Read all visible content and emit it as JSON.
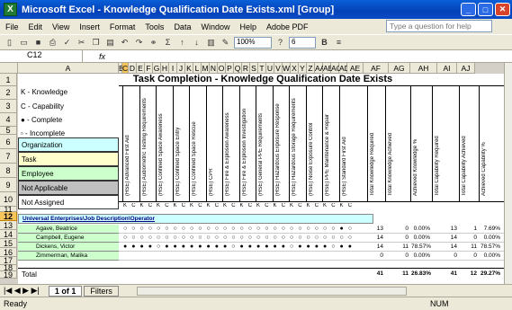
{
  "window": {
    "title": "Microsoft Excel - Knowledge Qualification Date Exists.xml  [Group]"
  },
  "menu": [
    "File",
    "Edit",
    "View",
    "Insert",
    "Format",
    "Tools",
    "Data",
    "Window",
    "Help",
    "Adobe PDF"
  ],
  "help_placeholder": "Type a question for help",
  "toolbar": {
    "zoom": "100%",
    "font_size": "6"
  },
  "formula": {
    "namebox": "C12",
    "fx": "fx"
  },
  "columns": [
    "A",
    "B",
    "C",
    "D",
    "E",
    "F",
    "G",
    "H",
    "I",
    "J",
    "K",
    "L",
    "M",
    "N",
    "O",
    "P",
    "Q",
    "R",
    "S",
    "T",
    "U",
    "V",
    "W",
    "X",
    "Y",
    "Z",
    "AA",
    "AB",
    "AC",
    "AD",
    "AE",
    "AF",
    "AG",
    "AH",
    "AI",
    "AJ"
  ],
  "sheet": {
    "title": "Task Completion  - Knowledge Qualification Date Exists",
    "legend": [
      "K - Knowledge",
      "C - Capability",
      "● - Complete",
      "▫ - Incomplete"
    ],
    "boxes": [
      {
        "label": "Organization",
        "color": "#ccffff"
      },
      {
        "label": "Task",
        "color": "#ffffcc"
      },
      {
        "label": "Employee",
        "color": "#ccffcc"
      },
      {
        "label": "Not Applicable",
        "color": "#c0c0c0"
      },
      {
        "label": "Not Assigned",
        "color": "#ffffff"
      }
    ],
    "tasks": [
      "(HSE) Advanced First Aid",
      "(HSE) Audiometric Testing Requirements",
      "(HSE) Confined Space Awareness",
      "(HSE) Confined Space Entry",
      "(HSE) Confined Space Rescue",
      "(HSE) CPR",
      "(HSE) Fire & Explosion Awareness",
      "(HSE) Fire & Explosion Investigation",
      "(HSE) General PPE Requirements",
      "(HSE) Hazardous Exposure Response",
      "(HSE) Hazardous Storage Requirements",
      "(HSE) Noise Exposure Control",
      "(HSE) PPE Maintenance & Repair",
      "(HSE) Standard First Aid"
    ],
    "summary_headers": [
      "Total Knowledge Required",
      "Total Knowledge Achieved",
      "Achieved Knowledge %",
      "Total Capability Required",
      "Total Capability Achieved",
      "Achieved Capability %"
    ],
    "kc_row": [
      "K",
      "C",
      "K",
      "C",
      "K",
      "C",
      "K",
      "C",
      "K",
      "C",
      "K",
      "C",
      "K",
      "C",
      "K",
      "C",
      "K",
      "C",
      "K",
      "C",
      "K",
      "C",
      "K",
      "C",
      "K",
      "C",
      "K",
      "C"
    ],
    "org": "Universal Enterprises\\Job Description\\Operator",
    "employees": [
      {
        "name": "Agave, Beatrice",
        "stats": [
          "13",
          "0",
          "0.00%",
          "13",
          "1",
          "7.69%"
        ]
      },
      {
        "name": "Campbell, Eugene",
        "stats": [
          "14",
          "0",
          "0.00%",
          "14",
          "0",
          "0.00%"
        ]
      },
      {
        "name": "Dickens, Victor",
        "stats": [
          "14",
          "11",
          "78.57%",
          "14",
          "11",
          "78.57%"
        ]
      },
      {
        "name": "Zimmerman, Malika",
        "stats": [
          "0",
          "0",
          "0.00%",
          "0",
          "0",
          "0.00%"
        ]
      }
    ],
    "total_label": "Total",
    "total": [
      "41",
      "11",
      "26.83%",
      "41",
      "12",
      "29.27%"
    ]
  },
  "sheet_tab": "1 of 1",
  "sheet_tab2": "Filters",
  "status": {
    "ready": "Ready",
    "num": "NUM"
  }
}
